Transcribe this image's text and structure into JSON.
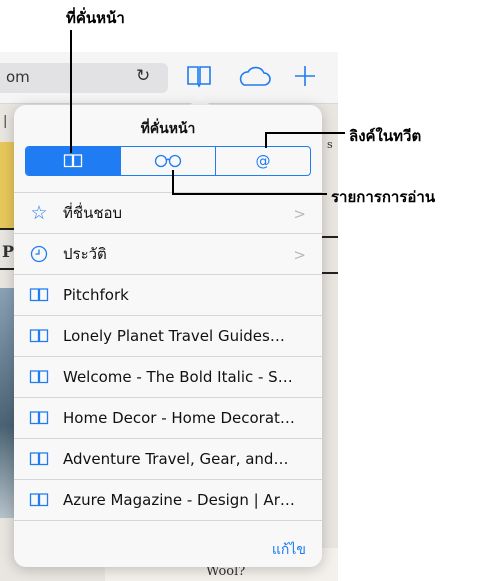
{
  "browser": {
    "url_fragment": "om",
    "reload_glyph": "↻",
    "icons": [
      "reload-icon",
      "bookmarks-book-icon",
      "icloud-tabs-icon",
      "new-tab-plus-icon"
    ]
  },
  "background_text": {
    "left_mark_1": "|",
    "left_mark_2": "P",
    "right_mark": "s",
    "bottom_word": "Wool?"
  },
  "popover": {
    "title": "ที่คั่นหน้า",
    "tabs": [
      {
        "name": "bookmarks",
        "icon": "book-icon",
        "glyph": "☷",
        "active": true
      },
      {
        "name": "reading-list",
        "icon": "glasses-icon",
        "glyph": "∞",
        "active": false
      },
      {
        "name": "shared-links",
        "icon": "at-icon",
        "glyph": "@",
        "active": false
      }
    ],
    "items": [
      {
        "label": "ที่ชื่นชอบ",
        "icon": "star-icon",
        "glyph": "☆",
        "folder": true
      },
      {
        "label": "ประวัติ",
        "icon": "clock-icon",
        "glyph": "◷",
        "folder": true
      },
      {
        "label": "Pitchfork",
        "icon": "book-icon",
        "glyph": "",
        "folder": false
      },
      {
        "label": "Lonely Planet Travel Guides…",
        "icon": "book-icon",
        "glyph": "",
        "folder": false
      },
      {
        "label": "Welcome - The Bold Italic - S…",
        "icon": "book-icon",
        "glyph": "",
        "folder": false
      },
      {
        "label": "Home Decor - Home Decorat…",
        "icon": "book-icon",
        "glyph": "",
        "folder": false
      },
      {
        "label": "Adventure Travel, Gear, and…",
        "icon": "book-icon",
        "glyph": "",
        "folder": false
      },
      {
        "label": "Azure Magazine - Design | Ar…",
        "icon": "book-icon",
        "glyph": "",
        "folder": false
      }
    ],
    "edit_label": "แก้ไข"
  },
  "callouts": {
    "bookmarks": "ที่คั่นหน้า",
    "shared_links": "ลิงค์ในทวีต",
    "reading_list": "รายการการอ่าน"
  },
  "colors": {
    "accent": "#1f7cf2",
    "separator": "#d6d6d9",
    "popover_bg": "#f8f8f9"
  }
}
